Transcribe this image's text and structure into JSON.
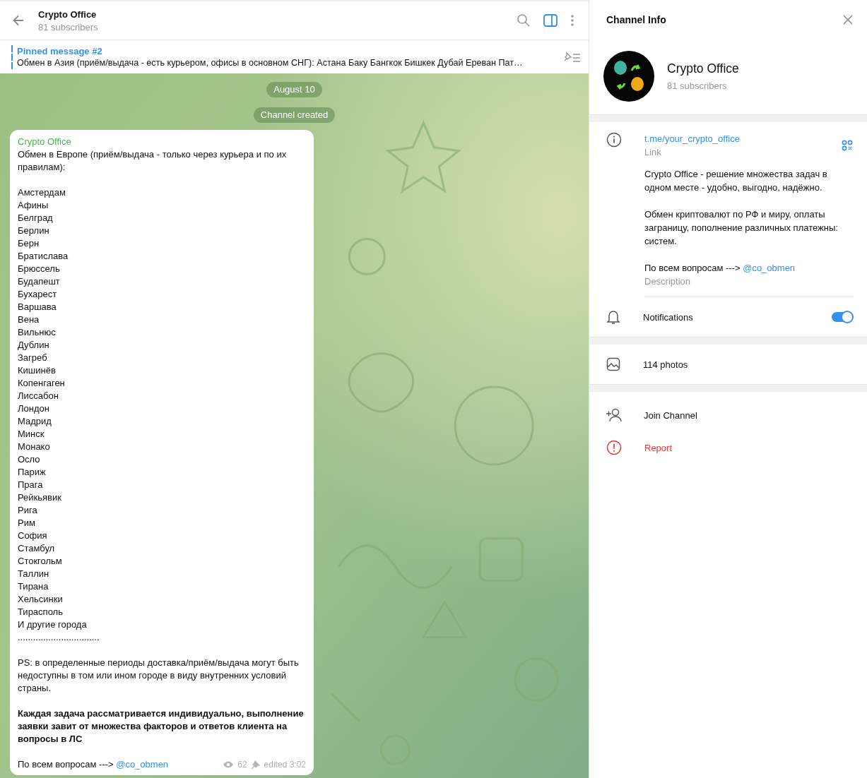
{
  "chat_header": {
    "title": "Crypto Office",
    "subtitle": "81 subscribers",
    "panel_toggle_active": true
  },
  "pinned": {
    "title": "Pinned message #2",
    "text": "Обмен в Азия (приём/выдача - есть курьером, офисы в основном СНГ):  Астана Баку Бангкок Бишкек Дубай Ереван Пат…"
  },
  "service_messages": [
    "August 10",
    "Channel created"
  ],
  "message": {
    "sender": "Crypto Office",
    "paragraphs": [
      {
        "kind": "text",
        "lines": [
          "Обмен в Европе (приём/выдача - только через курьера и по их правилам):"
        ]
      },
      {
        "kind": "text",
        "lines": [
          "Амстердам",
          "Афины",
          "Белград",
          "Берлин",
          "Берн",
          "Братислава",
          "Брюссель",
          "Будапешт",
          "Бухарест",
          "Варшава",
          "Вена",
          "Вильнюс",
          "Дублин",
          "Загреб",
          "Кишинёв",
          "Копенгаген",
          "Лиссабон",
          "Лондон",
          "Мадрид",
          "Минск",
          "Монако",
          "Осло",
          "Париж",
          "Прага",
          "Рейкьявик",
          "Рига",
          "Рим",
          "София",
          "Стамбул",
          "Стокгольм",
          "Таллин",
          "Тирана",
          "Хельсинки",
          "Тирасполь",
          "И другие города",
          "................................"
        ]
      },
      {
        "kind": "text",
        "lines": [
          "PS: в определенные периоды доставка/приём/выдача могут быть недоступны в том или ином городе в виду внутренних условий страны."
        ]
      },
      {
        "kind": "bold",
        "lines": [
          "Каждая задача рассматривается индивидуально, выполнение заявки завит от множества факторов и ответов клиента на вопросы в ЛС"
        ]
      },
      {
        "kind": "link",
        "text": "По всем вопросам --->",
        "link": "@co_obmen"
      }
    ],
    "views": "62",
    "pinned": true,
    "edited": "edited 3:02"
  },
  "info_panel": {
    "title": "Channel Info",
    "name": "Crypto Office",
    "subtitle": "81 subscribers",
    "link": "t.me/your_crypto_office",
    "link_label": "Link",
    "description": [
      "Crypto Office - решение множества задач в одном месте - удобно, выгодно, надёжно.",
      "Обмен криптовалют по РФ и миру, оплаты заграницу, пополнение различных платежны: систем."
    ],
    "description_contact": {
      "text": "По всем вопросам --->",
      "link": "@co_obmen"
    },
    "description_label": "Description",
    "notifications": {
      "label": "Notifications",
      "on": true
    },
    "photos": "114 photos",
    "actions": [
      {
        "kind": "join",
        "label": "Join Channel"
      },
      {
        "kind": "report",
        "label": "Report"
      }
    ]
  }
}
